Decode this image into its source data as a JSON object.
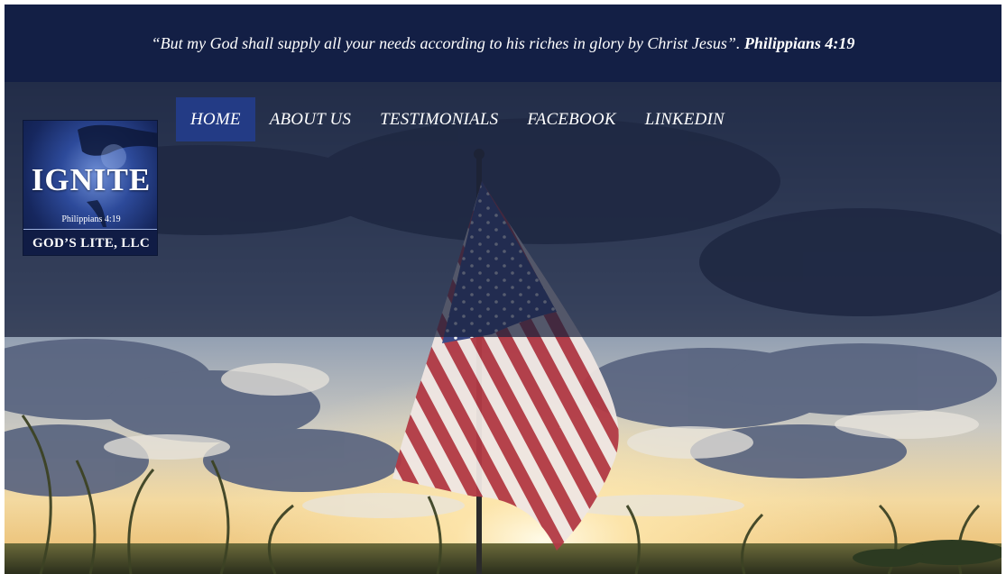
{
  "quote_bar": {
    "verse_text": "“But my God shall supply all your needs according to his riches in glory by Christ Jesus”.",
    "reference": "Philippians 4:19"
  },
  "nav": {
    "items": [
      {
        "label": "HOME",
        "active": true
      },
      {
        "label": "ABOUT US",
        "active": false
      },
      {
        "label": "TESTIMONIALS",
        "active": false
      },
      {
        "label": "FACEBOOK",
        "active": false
      },
      {
        "label": "LINKEDIN",
        "active": false
      }
    ]
  },
  "logo": {
    "brand": "IGNITE",
    "verse": "Philippians 4:19",
    "company": "GOD’S LITE, LLC"
  },
  "colors": {
    "quote_bar_bg": "#131f45",
    "header_overlay": "#19213c",
    "nav_active_bg": "#233b85",
    "text": "#ffffff"
  },
  "hero": {
    "image": "american-flag-in-field-at-sunset"
  }
}
